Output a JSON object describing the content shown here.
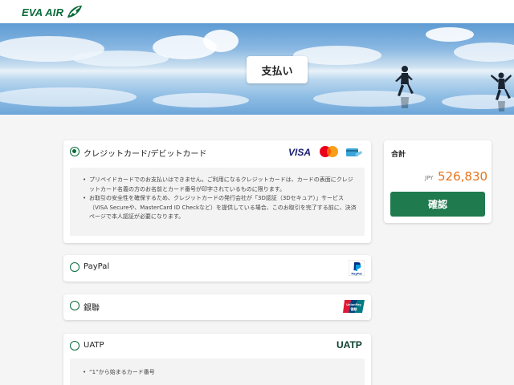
{
  "brand": {
    "name": "EVA AIR",
    "green": "#0a6b3a",
    "orange": "#e8731a"
  },
  "page": {
    "title": "支払い"
  },
  "payment_options": [
    {
      "label": "クレジットカード/デビットカード",
      "selected": true,
      "logos": [
        "VISA",
        "mastercard",
        "card-icon"
      ],
      "notes": [
        "プリペイドカードでのお支払いはできません。ご利用になるクレジットカードは、カードの表面にクレジットカード名義の方のお名前とカード番号が印字されているものに限ります。",
        "お取引の安全性を確保するため、クレジットカードの発行会社が「3D認証（3Dセキュア）」サービス（VISA Secureや、MasterCard ID Checkなど）を提供している場合、このお取引を完了する前に、決済ページで本人認証が必要になります。"
      ]
    },
    {
      "label": "PayPal",
      "selected": false,
      "logo": "PayPal"
    },
    {
      "label": "銀聯",
      "selected": false,
      "logo": "UnionPay 银联"
    },
    {
      "label": "UATP",
      "selected": false,
      "logo": "UATP",
      "notes": [
        "“1”から始まるカード番号"
      ]
    }
  ],
  "summary": {
    "label": "合計",
    "currency": "JPY",
    "amount": "526,830",
    "confirm_label": "確認"
  }
}
